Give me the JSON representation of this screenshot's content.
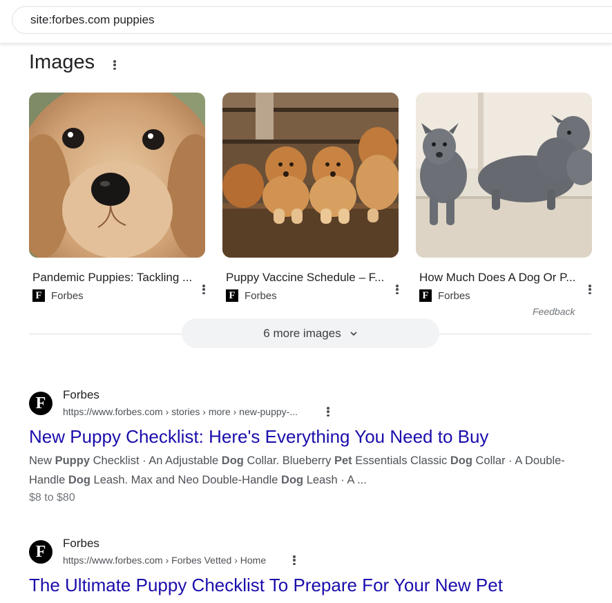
{
  "search": {
    "query": "site:forbes.com puppies"
  },
  "images_section": {
    "title": "Images",
    "cards": [
      {
        "title": "Pandemic Puppies: Tackling ...",
        "source": "Forbes",
        "source_logo": "F"
      },
      {
        "title": "Puppy Vaccine Schedule – F...",
        "source": "Forbes",
        "source_logo": "F"
      },
      {
        "title": "How Much Does A Dog Or P...",
        "source": "Forbes",
        "source_logo": "F"
      }
    ],
    "feedback": "Feedback",
    "more_button": "6 more images"
  },
  "results": [
    {
      "site": "Forbes",
      "favicon": "F",
      "url": "https://www.forbes.com › stories › more › new-puppy-...",
      "title": "New Puppy Checklist: Here's Everything You Need to Buy",
      "snippet_parts": [
        {
          "t": "New ",
          "b": false
        },
        {
          "t": "Puppy",
          "b": true
        },
        {
          "t": " Checklist · An Adjustable ",
          "b": false
        },
        {
          "t": "Dog",
          "b": true
        },
        {
          "t": " Collar. Blueberry ",
          "b": false
        },
        {
          "t": "Pet",
          "b": true
        },
        {
          "t": " Essentials Classic ",
          "b": false
        },
        {
          "t": "Dog",
          "b": true
        },
        {
          "t": " Collar · A Double-Handle ",
          "b": false
        },
        {
          "t": "Dog",
          "b": true
        },
        {
          "t": " Leash. Max and Neo Double-Handle ",
          "b": false
        },
        {
          "t": "Dog",
          "b": true
        },
        {
          "t": " Leash · A ...",
          "b": false
        }
      ],
      "price": "$8 to $80"
    },
    {
      "site": "Forbes",
      "favicon": "F",
      "url": "https://www.forbes.com › Forbes Vetted › Home",
      "title": "The Ultimate Puppy Checklist To Prepare For Your New Pet"
    }
  ],
  "colors": {
    "link": "#1a0dab",
    "text": "#202124",
    "muted": "#4d5156"
  }
}
